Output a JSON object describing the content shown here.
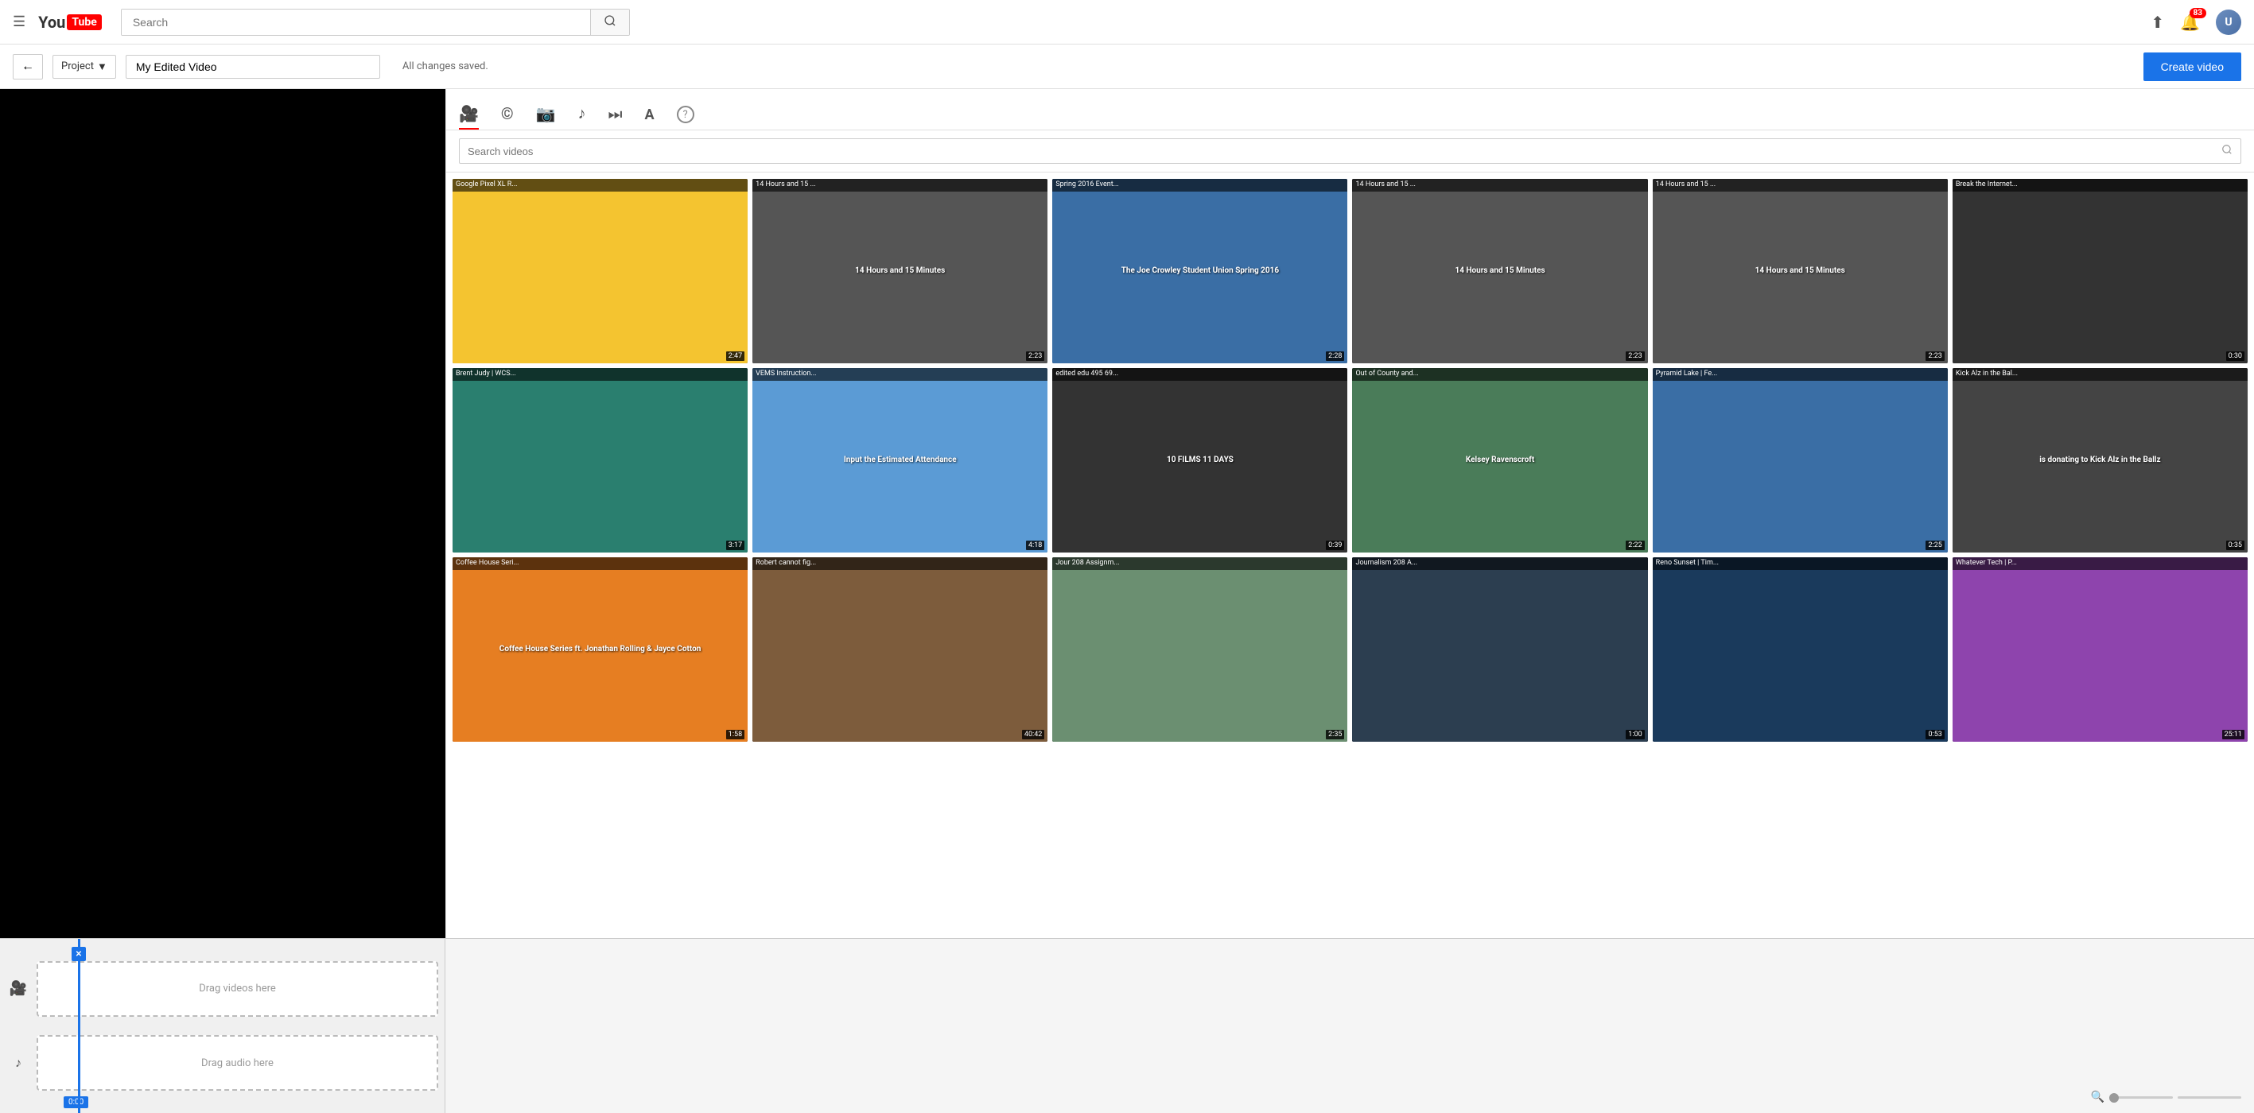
{
  "nav": {
    "search_placeholder": "Search",
    "notification_count": "83"
  },
  "editor": {
    "back_label": "←",
    "project_label": "Project",
    "project_dropdown_arrow": "▼",
    "project_name": "My Edited Video",
    "saved_status": "All changes saved.",
    "create_video_label": "Create video"
  },
  "media_tabs": [
    {
      "id": "video",
      "icon": "🎥",
      "active": true
    },
    {
      "id": "cc",
      "icon": "©"
    },
    {
      "id": "photo",
      "icon": "📷"
    },
    {
      "id": "music",
      "icon": "♪"
    },
    {
      "id": "transitions",
      "icon": "⏭"
    },
    {
      "id": "text",
      "icon": "A"
    },
    {
      "id": "help",
      "icon": "?"
    }
  ],
  "search": {
    "placeholder": "Search videos"
  },
  "videos": [
    {
      "title": "Google Pixel XL R...",
      "duration": "2:47",
      "bg": "thumb-bg-yellow",
      "text": ""
    },
    {
      "title": "14 Hours and 15 ...",
      "duration": "2:23",
      "bg": "thumb-bg-gray",
      "text": "14 Hours and 15 Minutes"
    },
    {
      "title": "Spring 2016 Event...",
      "duration": "2:28",
      "bg": "thumb-bg-blue",
      "text": "The Joe Crowley Student Union Spring 2016"
    },
    {
      "title": "14 Hours and 15 ...",
      "duration": "2:23",
      "bg": "thumb-bg-gray",
      "text": "14 Hours and 15 Minutes"
    },
    {
      "title": "14 Hours and 15 ...",
      "duration": "2:23",
      "bg": "thumb-bg-gray",
      "text": "14 Hours and 15 Minutes"
    },
    {
      "title": "Break the Internet...",
      "duration": "0:30",
      "bg": "thumb-bg-darkgray",
      "text": ""
    },
    {
      "title": "Brent Judy | WCS...",
      "duration": "3:17",
      "bg": "thumb-bg-teal",
      "text": ""
    },
    {
      "title": "VEMS Instruction...",
      "duration": "4:18",
      "bg": "thumb-bg-lightblue",
      "text": "Input the Estimated Attendance"
    },
    {
      "title": "edited edu 495 69...",
      "duration": "0:39",
      "bg": "thumb-bg-darkgray",
      "text": "10 FILMS 11 DAYS"
    },
    {
      "title": "Out of County and...",
      "duration": "2:22",
      "bg": "thumb-bg-green",
      "text": "Kelsey Ravenscroft"
    },
    {
      "title": "Pyramid Lake | Fe...",
      "duration": "2:25",
      "bg": "thumb-bg-blue",
      "text": ""
    },
    {
      "title": "Kick Alz in the Bal...",
      "duration": "0:35",
      "bg": "thumb-bg-charcoal",
      "text": "is donating to Kick Alz in the Ballz"
    },
    {
      "title": "Coffee House Seri...",
      "duration": "1:58",
      "bg": "thumb-bg-orange",
      "text": "Coffee House Series ft. Jonathan Rolling & Jayce Cotton"
    },
    {
      "title": "Robert cannot fig...",
      "duration": "40:42",
      "bg": "thumb-bg-brown",
      "text": ""
    },
    {
      "title": "Jour 208 Assignm...",
      "duration": "2:35",
      "bg": "thumb-bg-sage",
      "text": ""
    },
    {
      "title": "Journalism 208 A...",
      "duration": "1:00",
      "bg": "thumb-bg-navy",
      "text": ""
    },
    {
      "title": "Reno Sunset | Tim...",
      "duration": "0:53",
      "bg": "thumb-bg-darkblue",
      "text": ""
    },
    {
      "title": "Whatever Tech | P...",
      "duration": "25:11",
      "bg": "thumb-bg-purple",
      "text": ""
    }
  ],
  "timeline": {
    "video_track_label": "Drag videos here",
    "audio_track_label": "Drag audio here",
    "timestamp": "0:00"
  }
}
